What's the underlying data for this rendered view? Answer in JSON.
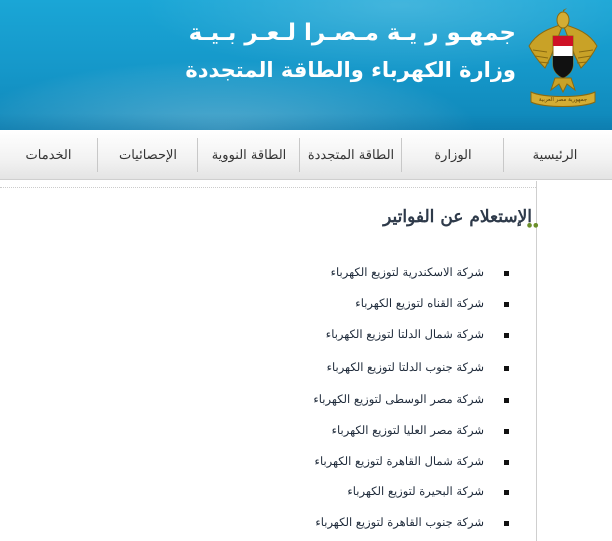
{
  "header": {
    "title_line1": "جمهـو ر يـة مـصـرا لـعـر بـيـة",
    "title_line2": "وزارة الكهرباء والطاقة المتجددة",
    "emblem_text": "جمهورية مصر العربية",
    "background_color": "#1aa6d6"
  },
  "nav": {
    "items": [
      {
        "label": "الرئيسية"
      },
      {
        "label": "الوزارة"
      },
      {
        "label": "الطاقة المتجددة"
      },
      {
        "label": "الطاقة النووية"
      },
      {
        "label": "الإحصائيات"
      },
      {
        "label": "الخدمات"
      }
    ]
  },
  "section": {
    "title": "الإستعلام عن الفواتير",
    "title_bullet_color": "#6b8f2b"
  },
  "companies": [
    {
      "label": "شركة الاسكندرية لتوزيع الكهرباء"
    },
    {
      "label": "شركة القناه لتوزيع الكهرباء"
    },
    {
      "label": "شركة شمال الدلتا لتوزيع الكهرباء"
    },
    {
      "label": "شركة جنوب الدلتا لتوزيع الكهرباء"
    },
    {
      "label": "شركة مصر الوسطى لتوزيع الكهرباء"
    },
    {
      "label": "شركة مصر العليا لتوزيع الكهرباء"
    },
    {
      "label": "شركة شمال القاهرة لتوزيع الكهرباء"
    },
    {
      "label": "شركة البحيرة لتوزيع الكهرباء"
    },
    {
      "label": "شركة جنوب القاهرة لتوزيع الكهرباء"
    }
  ]
}
